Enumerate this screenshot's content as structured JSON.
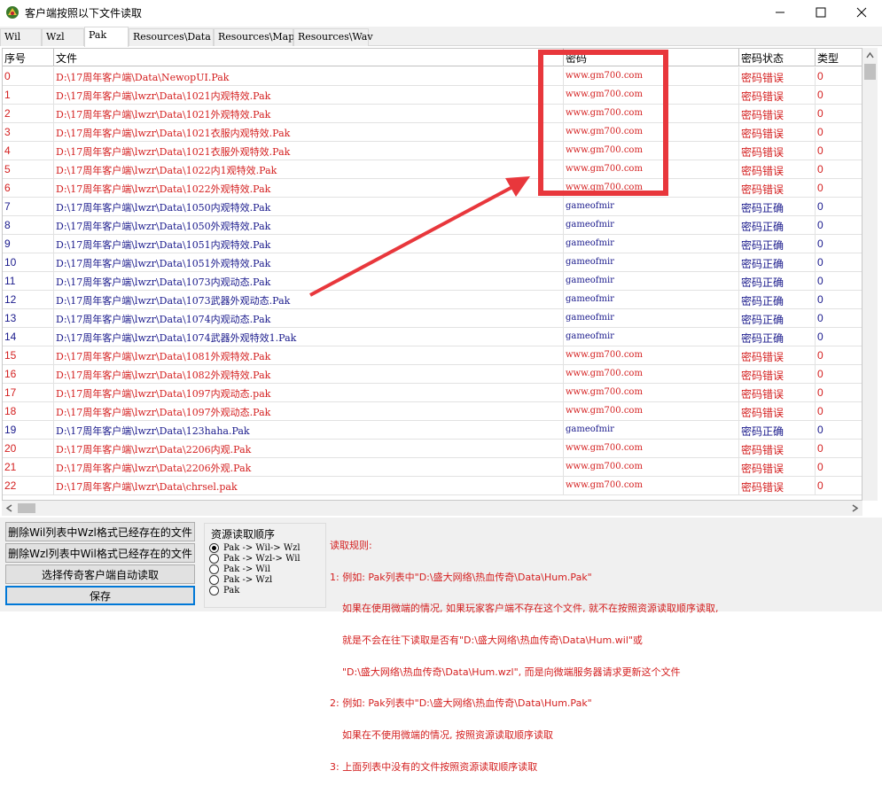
{
  "window": {
    "title": "客户端按照以下文件读取"
  },
  "tabs": [
    {
      "label": "Wil",
      "active": false
    },
    {
      "label": "Wzl",
      "active": false
    },
    {
      "label": "Pak",
      "active": true
    },
    {
      "label": "Resources\\Data",
      "active": false
    },
    {
      "label": "Resources\\Map",
      "active": false
    },
    {
      "label": "Resources\\Wav",
      "active": false
    }
  ],
  "table": {
    "columns": [
      "序号",
      "文件",
      "密码",
      "密码状态",
      "类型"
    ],
    "rows": [
      {
        "idx": "0",
        "file": "D:\\17周年客户端\\Data\\NewopUI.Pak",
        "pwd": "www.gm700.com",
        "status": "密码错误",
        "type": "0",
        "ok": false
      },
      {
        "idx": "1",
        "file": "D:\\17周年客户端\\lwzr\\Data\\1021内观特效.Pak",
        "pwd": "www.gm700.com",
        "status": "密码错误",
        "type": "0",
        "ok": false
      },
      {
        "idx": "2",
        "file": "D:\\17周年客户端\\lwzr\\Data\\1021外观特效.Pak",
        "pwd": "www.gm700.com",
        "status": "密码错误",
        "type": "0",
        "ok": false
      },
      {
        "idx": "3",
        "file": "D:\\17周年客户端\\lwzr\\Data\\1021衣服内观特效.Pak",
        "pwd": "www.gm700.com",
        "status": "密码错误",
        "type": "0",
        "ok": false
      },
      {
        "idx": "4",
        "file": "D:\\17周年客户端\\lwzr\\Data\\1021衣服外观特效.Pak",
        "pwd": "www.gm700.com",
        "status": "密码错误",
        "type": "0",
        "ok": false
      },
      {
        "idx": "5",
        "file": "D:\\17周年客户端\\lwzr\\Data\\1022内1观特效.Pak",
        "pwd": "www.gm700.com",
        "status": "密码错误",
        "type": "0",
        "ok": false
      },
      {
        "idx": "6",
        "file": "D:\\17周年客户端\\lwzr\\Data\\1022外观特效.Pak",
        "pwd": "www.gm700.com",
        "status": "密码错误",
        "type": "0",
        "ok": false
      },
      {
        "idx": "7",
        "file": "D:\\17周年客户端\\lwzr\\Data\\1050内观特效.Pak",
        "pwd": "gameofmir",
        "status": "密码正确",
        "type": "0",
        "ok": true
      },
      {
        "idx": "8",
        "file": "D:\\17周年客户端\\lwzr\\Data\\1050外观特效.Pak",
        "pwd": "gameofmir",
        "status": "密码正确",
        "type": "0",
        "ok": true
      },
      {
        "idx": "9",
        "file": "D:\\17周年客户端\\lwzr\\Data\\1051内观特效.Pak",
        "pwd": "gameofmir",
        "status": "密码正确",
        "type": "0",
        "ok": true
      },
      {
        "idx": "10",
        "file": "D:\\17周年客户端\\lwzr\\Data\\1051外观特效.Pak",
        "pwd": "gameofmir",
        "status": "密码正确",
        "type": "0",
        "ok": true
      },
      {
        "idx": "11",
        "file": "D:\\17周年客户端\\lwzr\\Data\\1073内观动态.Pak",
        "pwd": "gameofmir",
        "status": "密码正确",
        "type": "0",
        "ok": true
      },
      {
        "idx": "12",
        "file": "D:\\17周年客户端\\lwzr\\Data\\1073武器外观动态.Pak",
        "pwd": "gameofmir",
        "status": "密码正确",
        "type": "0",
        "ok": true
      },
      {
        "idx": "13",
        "file": "D:\\17周年客户端\\lwzr\\Data\\1074内观动态.Pak",
        "pwd": "gameofmir",
        "status": "密码正确",
        "type": "0",
        "ok": true
      },
      {
        "idx": "14",
        "file": "D:\\17周年客户端\\lwzr\\Data\\1074武器外观特效1.Pak",
        "pwd": "gameofmir",
        "status": "密码正确",
        "type": "0",
        "ok": true
      },
      {
        "idx": "15",
        "file": "D:\\17周年客户端\\lwzr\\Data\\1081外观特效.Pak",
        "pwd": "www.gm700.com",
        "status": "密码错误",
        "type": "0",
        "ok": false
      },
      {
        "idx": "16",
        "file": "D:\\17周年客户端\\lwzr\\Data\\1082外观特效.Pak",
        "pwd": "www.gm700.com",
        "status": "密码错误",
        "type": "0",
        "ok": false
      },
      {
        "idx": "17",
        "file": "D:\\17周年客户端\\lwzr\\Data\\1097内观动态.pak",
        "pwd": "www.gm700.com",
        "status": "密码错误",
        "type": "0",
        "ok": false
      },
      {
        "idx": "18",
        "file": "D:\\17周年客户端\\lwzr\\Data\\1097外观动态.Pak",
        "pwd": "www.gm700.com",
        "status": "密码错误",
        "type": "0",
        "ok": false
      },
      {
        "idx": "19",
        "file": "D:\\17周年客户端\\lwzr\\Data\\123haha.Pak",
        "pwd": "gameofmir",
        "status": "密码正确",
        "type": "0",
        "ok": true
      },
      {
        "idx": "20",
        "file": "D:\\17周年客户端\\lwzr\\Data\\2206内观.Pak",
        "pwd": "www.gm700.com",
        "status": "密码错误",
        "type": "0",
        "ok": false
      },
      {
        "idx": "21",
        "file": "D:\\17周年客户端\\lwzr\\Data\\2206外观.Pak",
        "pwd": "www.gm700.com",
        "status": "密码错误",
        "type": "0",
        "ok": false
      },
      {
        "idx": "22",
        "file": "D:\\17周年客户端\\lwzr\\Data\\chrsel.pak",
        "pwd": "www.gm700.com",
        "status": "密码错误",
        "type": "0",
        "ok": false
      }
    ]
  },
  "buttons": {
    "delete_wil": "删除Wil列表中Wzl格式已经存在的文件",
    "delete_wzl": "删除Wzl列表中Wil格式已经存在的文件",
    "select_client": "选择传奇客户端自动读取",
    "save": "保存"
  },
  "read_order": {
    "title": "资源读取顺序",
    "options": [
      {
        "label": "Pak -> Wil-> Wzl",
        "checked": true
      },
      {
        "label": "Pak -> Wzl-> Wil",
        "checked": false
      },
      {
        "label": "Pak -> Wil",
        "checked": false
      },
      {
        "label": "Pak -> Wzl",
        "checked": false
      },
      {
        "label": "Pak",
        "checked": false
      }
    ]
  },
  "rules": {
    "title": "读取规则:",
    "lines": [
      "1: 例如: Pak列表中\"D:\\盛大网络\\热血传奇\\Data\\Hum.Pak\"",
      "    如果在使用微端的情况, 如果玩家客户端不存在这个文件, 就不在按照资源读取顺序读取,",
      "    就是不会在往下读取是否有\"D:\\盛大网络\\热血传奇\\Data\\Hum.wil\"或",
      "    \"D:\\盛大网络\\热血传奇\\Data\\Hum.wzl\", 而是向微端服务器请求更新这个文件",
      "2: 例如: Pak列表中\"D:\\盛大网络\\热血传奇\\Data\\Hum.Pak\"",
      "    如果在不使用微端的情况, 按照资源读取顺序读取",
      "3: 上面列表中没有的文件按照资源读取顺序读取"
    ]
  },
  "colors": {
    "error": "#d42020",
    "ok": "#1a1a8c",
    "annotation": "#e8373c"
  }
}
